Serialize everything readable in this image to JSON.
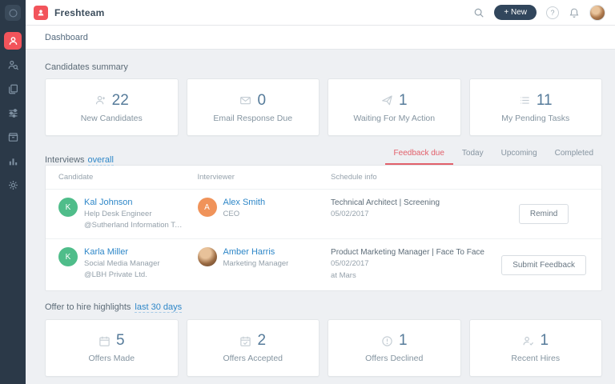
{
  "topbar": {
    "app_name": "Freshteam",
    "new_button_label": "+ New",
    "help_label": "?"
  },
  "subheader": {
    "title": "Dashboard"
  },
  "sidebar": {
    "items": [
      {
        "name": "dashboard",
        "active": true
      },
      {
        "name": "candidates",
        "active": false
      },
      {
        "name": "job-postings",
        "active": false
      },
      {
        "name": "interviews",
        "active": false
      },
      {
        "name": "talent-pool",
        "active": false
      },
      {
        "name": "reports",
        "active": false
      },
      {
        "name": "settings",
        "active": false
      }
    ]
  },
  "candidates_summary": {
    "title": "Candidates summary",
    "cards": [
      {
        "icon": "person-icon",
        "value": "22",
        "label": "New Candidates"
      },
      {
        "icon": "email-icon",
        "value": "0",
        "label": "Email Response Due"
      },
      {
        "icon": "paper-plane-icon",
        "value": "1",
        "label": "Waiting For My Action"
      },
      {
        "icon": "tasks-icon",
        "value": "11",
        "label": "My Pending Tasks"
      }
    ]
  },
  "interviews": {
    "title": "Interviews",
    "scope_filter": "overall",
    "tabs": [
      {
        "label": "Feedback due",
        "active": true
      },
      {
        "label": "Today",
        "active": false
      },
      {
        "label": "Upcoming",
        "active": false
      },
      {
        "label": "Completed",
        "active": false
      }
    ],
    "columns": {
      "candidate": "Candidate",
      "interviewer": "Interviewer",
      "schedule": "Schedule info"
    },
    "rows": [
      {
        "candidate": {
          "initial": "K",
          "avatar_color": "#4fbd8a",
          "name": "Kal Johnson",
          "role": "Help Desk Engineer",
          "company": "@Sutherland Information Technolo..."
        },
        "interviewer": {
          "initial": "A",
          "avatar_color": "#f0935a",
          "name": "Alex Smith",
          "role": "CEO"
        },
        "schedule": {
          "title": "Technical Architect | Screening",
          "date": "05/02/2017",
          "location": ""
        },
        "action_label": "Remind"
      },
      {
        "candidate": {
          "initial": "K",
          "avatar_color": "#4fbd8a",
          "name": "Karla Miller",
          "role": "Social Media Manager",
          "company": "@LBH Private Ltd."
        },
        "interviewer": {
          "initial": "",
          "avatar_color": "photo",
          "name": "Amber Harris",
          "role": "Marketing Manager"
        },
        "schedule": {
          "title": "Product Marketing Manager | Face To Face",
          "date": "05/02/2017",
          "location": "at Mars"
        },
        "action_label": "Submit Feedback"
      }
    ]
  },
  "offer_highlights": {
    "title": "Offer to hire highlights",
    "range_filter": "last 30 days",
    "cards": [
      {
        "icon": "calendar-icon",
        "value": "5",
        "label": "Offers Made"
      },
      {
        "icon": "calendar-check-icon",
        "value": "2",
        "label": "Offers Accepted"
      },
      {
        "icon": "alert-icon",
        "value": "1",
        "label": "Offers Declined"
      },
      {
        "icon": "person-check-icon",
        "value": "1",
        "label": "Recent Hires"
      }
    ]
  },
  "colors": {
    "accent": "#f2545b",
    "sidebar_bg": "#2b3948",
    "link": "#2e87c8",
    "tab_active": "#e2606b",
    "number": "#567b9a"
  }
}
